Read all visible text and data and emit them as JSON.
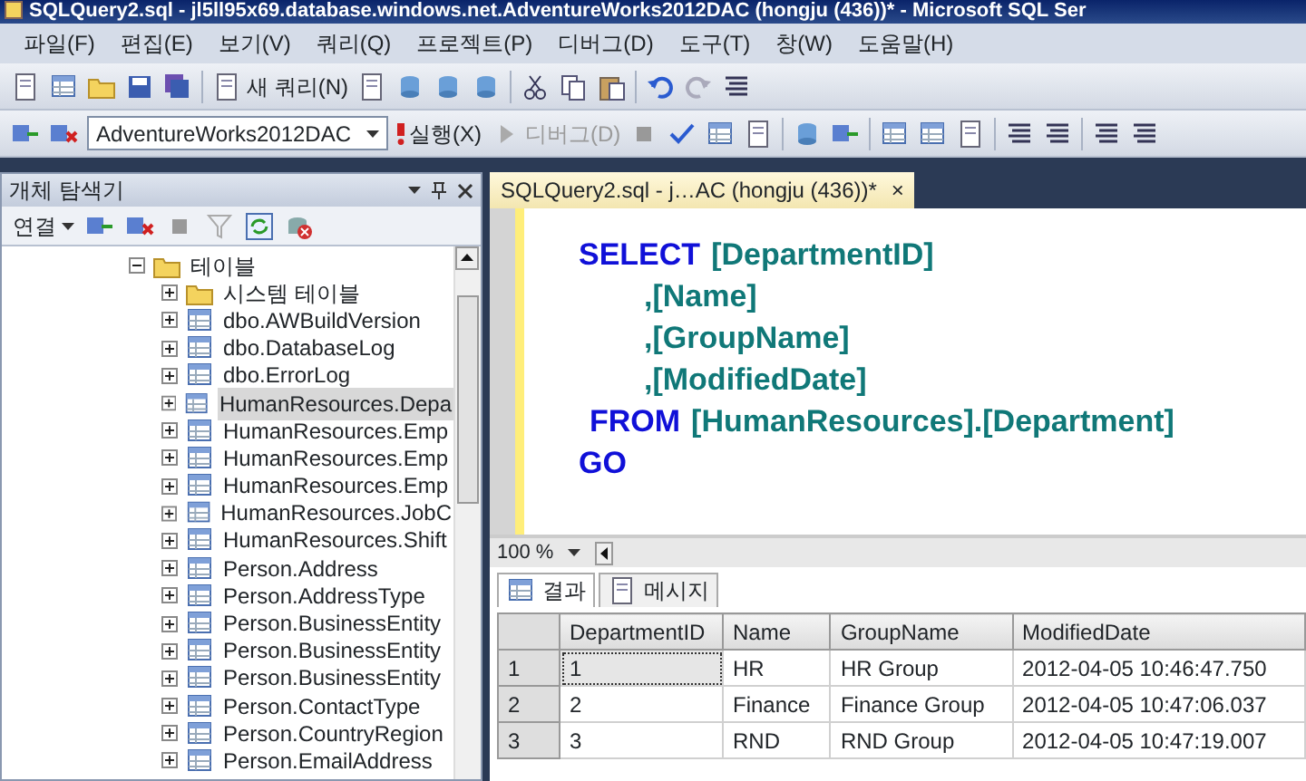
{
  "window": {
    "title": "SQLQuery2.sql - jl5ll95x69.database.windows.net.AdventureWorks2012DAC (hongju (436))* - Microsoft SQL Ser"
  },
  "menu": [
    "파일(F)",
    "편집(E)",
    "보기(V)",
    "쿼리(Q)",
    "프로젝트(P)",
    "디버그(D)",
    "도구(T)",
    "창(W)",
    "도움말(H)"
  ],
  "toolbar_1": {
    "new_query": "새 쿼리(N)"
  },
  "toolbar_2": {
    "database": "AdventureWorks2012DAC",
    "execute": "실행(X)",
    "debug": {
      "label": "디버그(D)",
      "disabled": true
    }
  },
  "object_explorer": {
    "title": "개체 탐색기",
    "connect": "연결",
    "tree": [
      {
        "label": "테이블",
        "kind": "folder",
        "expanded": true,
        "selected": false,
        "children": [
          {
            "label": "시스템 테이블",
            "kind": "folder",
            "expanded": false,
            "selected": false
          },
          {
            "label": "dbo.AWBuildVersion",
            "kind": "table",
            "expanded": false,
            "selected": false
          },
          {
            "label": "dbo.DatabaseLog",
            "kind": "table",
            "expanded": false,
            "selected": false
          },
          {
            "label": "dbo.ErrorLog",
            "kind": "table",
            "expanded": false,
            "selected": false
          },
          {
            "label": "HumanResources.Depa",
            "kind": "table",
            "expanded": false,
            "selected": true
          },
          {
            "label": "HumanResources.Emp",
            "kind": "table",
            "expanded": false,
            "selected": false
          },
          {
            "label": "HumanResources.Emp",
            "kind": "table",
            "expanded": false,
            "selected": false
          },
          {
            "label": "HumanResources.Emp",
            "kind": "table",
            "expanded": false,
            "selected": false
          },
          {
            "label": "HumanResources.JobC",
            "kind": "table",
            "expanded": false,
            "selected": false
          },
          {
            "label": "HumanResources.Shift",
            "kind": "table",
            "expanded": false,
            "selected": false
          },
          {
            "label": "Person.Address",
            "kind": "table",
            "expanded": false,
            "selected": false
          },
          {
            "label": "Person.AddressType",
            "kind": "table",
            "expanded": false,
            "selected": false
          },
          {
            "label": "Person.BusinessEntity",
            "kind": "table",
            "expanded": false,
            "selected": false
          },
          {
            "label": "Person.BusinessEntity",
            "kind": "table",
            "expanded": false,
            "selected": false
          },
          {
            "label": "Person.BusinessEntity",
            "kind": "table",
            "expanded": false,
            "selected": false
          },
          {
            "label": "Person.ContactType",
            "kind": "table",
            "expanded": false,
            "selected": false
          },
          {
            "label": "Person.CountryRegion",
            "kind": "table",
            "expanded": false,
            "selected": false
          },
          {
            "label": "Person.EmailAddress",
            "kind": "table",
            "expanded": false,
            "selected": false
          }
        ]
      }
    ]
  },
  "editor": {
    "tab": {
      "label": "SQLQuery2.sql - j…AC (hongju (436))*",
      "close": "×"
    },
    "lines": [
      {
        "kind": "statement",
        "segments": [
          {
            "kind": "keyword",
            "text": "SELECT"
          },
          {
            "kind": "ident",
            "text": "[DepartmentID]"
          }
        ]
      },
      {
        "kind": "column",
        "segments": [
          {
            "kind": "ident",
            "text": ",[Name]"
          }
        ]
      },
      {
        "kind": "column",
        "segments": [
          {
            "kind": "ident",
            "text": ",[GroupName]"
          }
        ]
      },
      {
        "kind": "column",
        "segments": [
          {
            "kind": "ident",
            "text": ",[ModifiedDate]"
          }
        ]
      },
      {
        "kind": "clause",
        "segments": [
          {
            "kind": "keyword",
            "text": "FROM"
          },
          {
            "kind": "ident",
            "text": "[HumanResources].[Department]"
          }
        ]
      },
      {
        "kind": "statement",
        "segments": [
          {
            "kind": "keyword",
            "text": "GO"
          }
        ]
      }
    ],
    "zoom": "100 %"
  },
  "results": {
    "tabs": [
      {
        "label": "결과",
        "selected": true
      },
      {
        "label": "메시지",
        "selected": false
      }
    ],
    "columns": [
      "DepartmentID",
      "Name",
      "GroupName",
      "ModifiedDate"
    ],
    "rows": [
      {
        "header": "1",
        "cells": [
          {
            "text": "1",
            "selected": true
          },
          {
            "text": "HR",
            "selected": false
          },
          {
            "text": "HR Group",
            "selected": false
          },
          {
            "text": "2012-04-05 10:46:47.750",
            "selected": false
          }
        ]
      },
      {
        "header": "2",
        "cells": [
          {
            "text": "2",
            "selected": false
          },
          {
            "text": "Finance",
            "selected": false
          },
          {
            "text": "Finance Group",
            "selected": false
          },
          {
            "text": "2012-04-05 10:47:06.037",
            "selected": false
          }
        ]
      },
      {
        "header": "3",
        "cells": [
          {
            "text": "3",
            "selected": false
          },
          {
            "text": "RND",
            "selected": false
          },
          {
            "text": "RND Group",
            "selected": false
          },
          {
            "text": "2012-04-05 10:47:19.007",
            "selected": false
          }
        ]
      }
    ]
  }
}
